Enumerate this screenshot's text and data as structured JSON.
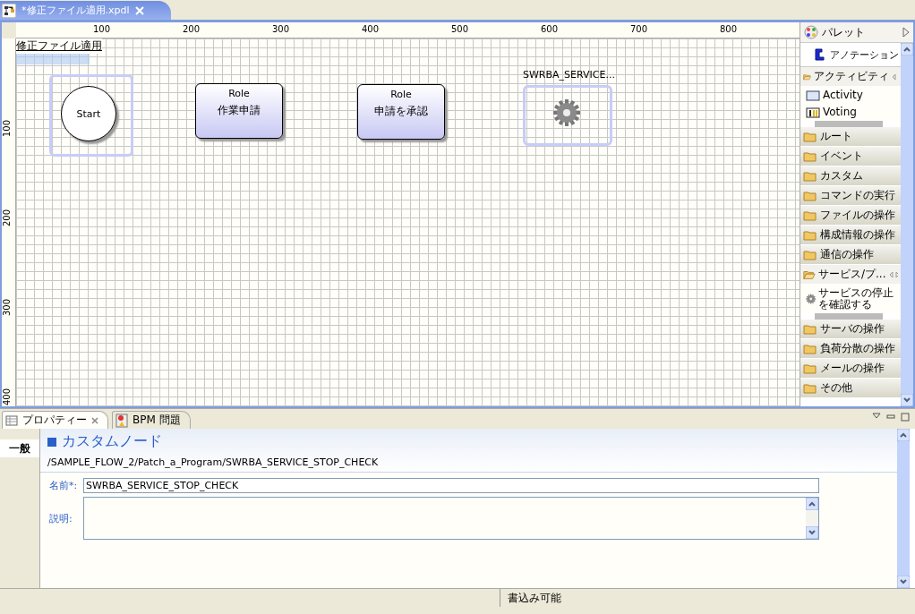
{
  "editor_tab": {
    "title": "*修正ファイル適用.xpdl",
    "selected": true
  },
  "ruler": {
    "x_labels": [
      "100",
      "200",
      "300",
      "400",
      "500",
      "600",
      "700",
      "800"
    ],
    "y_labels": [
      "100",
      "200",
      "300",
      "400"
    ]
  },
  "lane": {
    "label": "修正ファイル適用"
  },
  "nodes": [
    {
      "kind": "start",
      "label": "Start",
      "selected": true
    },
    {
      "kind": "role",
      "role": "Role",
      "label": "作業申請",
      "selected": false
    },
    {
      "kind": "role",
      "role": "Role",
      "label": "申請を承認",
      "selected": false
    },
    {
      "kind": "custom",
      "label": "SWRBA_SERVICE...",
      "selected": true
    }
  ],
  "palette": {
    "title": "パレット",
    "tools": [
      {
        "label": "アノテーション"
      }
    ],
    "drawers": [
      {
        "label": "アクティビティ",
        "expanded": true,
        "children": [
          {
            "kind": "activity",
            "label": "Activity"
          },
          {
            "kind": "voting",
            "label": "Voting"
          }
        ]
      },
      {
        "label": "ルート",
        "expanded": false
      },
      {
        "label": "イベント",
        "expanded": false
      },
      {
        "label": "カスタム",
        "expanded": false
      },
      {
        "label": "コマンドの実行",
        "expanded": false
      },
      {
        "label": "ファイルの操作",
        "expanded": false
      },
      {
        "label": "構成情報の操作",
        "expanded": false
      },
      {
        "label": "通信の操作",
        "expanded": false
      },
      {
        "label": "サービス/プ...",
        "expanded": true,
        "children": [
          {
            "kind": "service",
            "label": "サービスの停止を確認する"
          }
        ]
      },
      {
        "label": "サーバの操作",
        "expanded": false
      },
      {
        "label": "負荷分散の操作",
        "expanded": false
      },
      {
        "label": "メールの操作",
        "expanded": false
      },
      {
        "label": "その他",
        "expanded": false
      }
    ]
  },
  "panel_tabs": [
    {
      "kind": "properties",
      "label": "プロパティー",
      "selected": true
    },
    {
      "kind": "problems",
      "label": "BPM 問題",
      "selected": false
    }
  ],
  "properties": {
    "side_tabs": [
      {
        "label": "一般",
        "selected": true
      }
    ],
    "title": "カスタムノード",
    "path": "/SAMPLE_FLOW_2/Patch_a_Program/SWRBA_SERVICE_STOP_CHECK",
    "fields": [
      {
        "kind": "text",
        "label": "名前*:",
        "value": "SWRBA_SERVICE_STOP_CHECK"
      },
      {
        "kind": "textarea",
        "label": "説明:"
      }
    ]
  },
  "status_bar": {
    "text": "書込み可能"
  }
}
